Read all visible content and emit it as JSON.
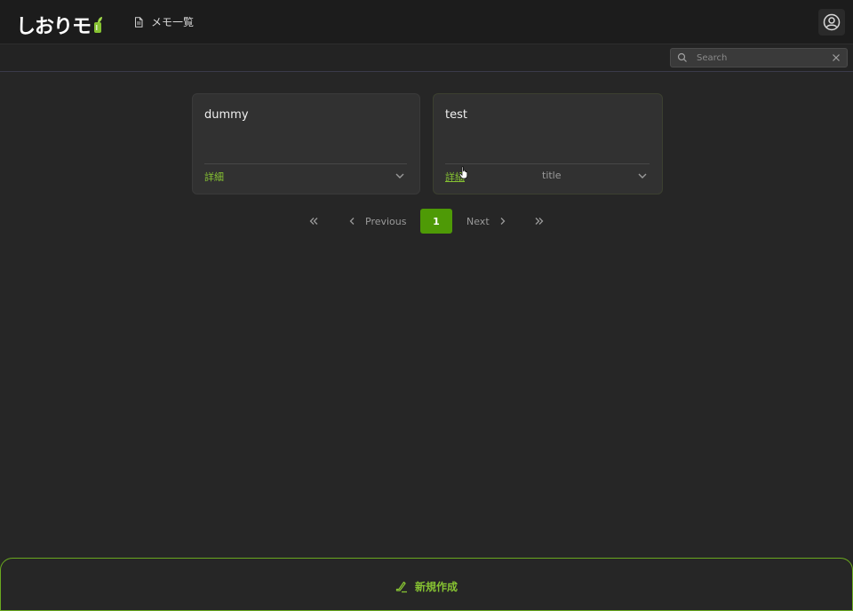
{
  "header": {
    "logo_text": "しおりモ",
    "nav_label": "メモ一覧"
  },
  "search": {
    "placeholder": "Search",
    "value": ""
  },
  "cards": [
    {
      "title": "dummy",
      "detail_label": "詳細",
      "meta": ""
    },
    {
      "title": "test",
      "detail_label": "詳細",
      "meta": "title"
    }
  ],
  "pagination": {
    "previous_label": "Previous",
    "next_label": "Next",
    "current_page": "1"
  },
  "footer": {
    "create_label": "新規作成"
  },
  "colors": {
    "accent": "#86c232",
    "active_page": "#4e9a06",
    "background": "#262626"
  },
  "icons": {
    "nav": "document-icon",
    "account": "user-circle-icon",
    "search": "search-icon",
    "clear": "close-icon",
    "expand": "chevron-down-icon",
    "first": "double-chevron-left-icon",
    "prev": "chevron-left-icon",
    "next": "chevron-right-icon",
    "last": "double-chevron-right-icon",
    "create": "pen-icon"
  }
}
